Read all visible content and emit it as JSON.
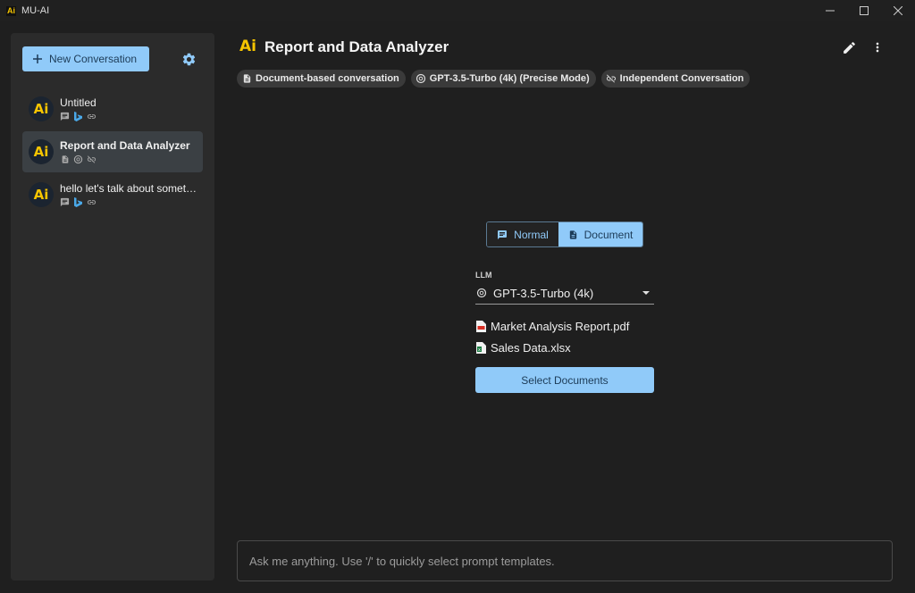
{
  "window": {
    "title": "MU-AI",
    "logo_text": "Ai"
  },
  "sidebar": {
    "new_conversation_label": "New Conversation",
    "conversations": [
      {
        "title": "Untitled",
        "avatar": "Ai",
        "icons": [
          "chat-icon",
          "bing-icon",
          "link-icon"
        ],
        "active": false
      },
      {
        "title": "Report and Data Analyzer",
        "avatar": "Ai",
        "icons": [
          "document-icon",
          "openai-icon",
          "link-off-icon"
        ],
        "active": true
      },
      {
        "title": "hello let's talk about someth…",
        "avatar": "Ai",
        "icons": [
          "chat-icon",
          "bing-icon",
          "link-icon"
        ],
        "active": false
      }
    ]
  },
  "header": {
    "logo_text": "Ai",
    "title": "Report and Data Analyzer",
    "chips": [
      {
        "label": "Document-based conversation",
        "icon": "document-icon"
      },
      {
        "label": "GPT-3.5-Turbo (4k) (Precise Mode)",
        "icon": "openai-icon"
      },
      {
        "label": "Independent Conversation",
        "icon": "link-off-icon"
      }
    ]
  },
  "mode_toggle": {
    "normal_label": "Normal",
    "document_label": "Document",
    "selected": "Document"
  },
  "llm": {
    "label": "LLM",
    "value": "GPT-3.5-Turbo (4k)"
  },
  "files": [
    {
      "name": "Market Analysis Report.pdf",
      "icon": "pdf-file-icon"
    },
    {
      "name": "Sales Data.xlsx",
      "icon": "excel-file-icon"
    }
  ],
  "select_documents_label": "Select Documents",
  "chat_input": {
    "placeholder": "Ask me anything. Use '/' to quickly select prompt templates."
  },
  "colors": {
    "accent": "#90caf9",
    "logo_yellow": "#f5c400",
    "background": "#1f1f1f",
    "sidebar_bg": "#2b2b2b"
  }
}
